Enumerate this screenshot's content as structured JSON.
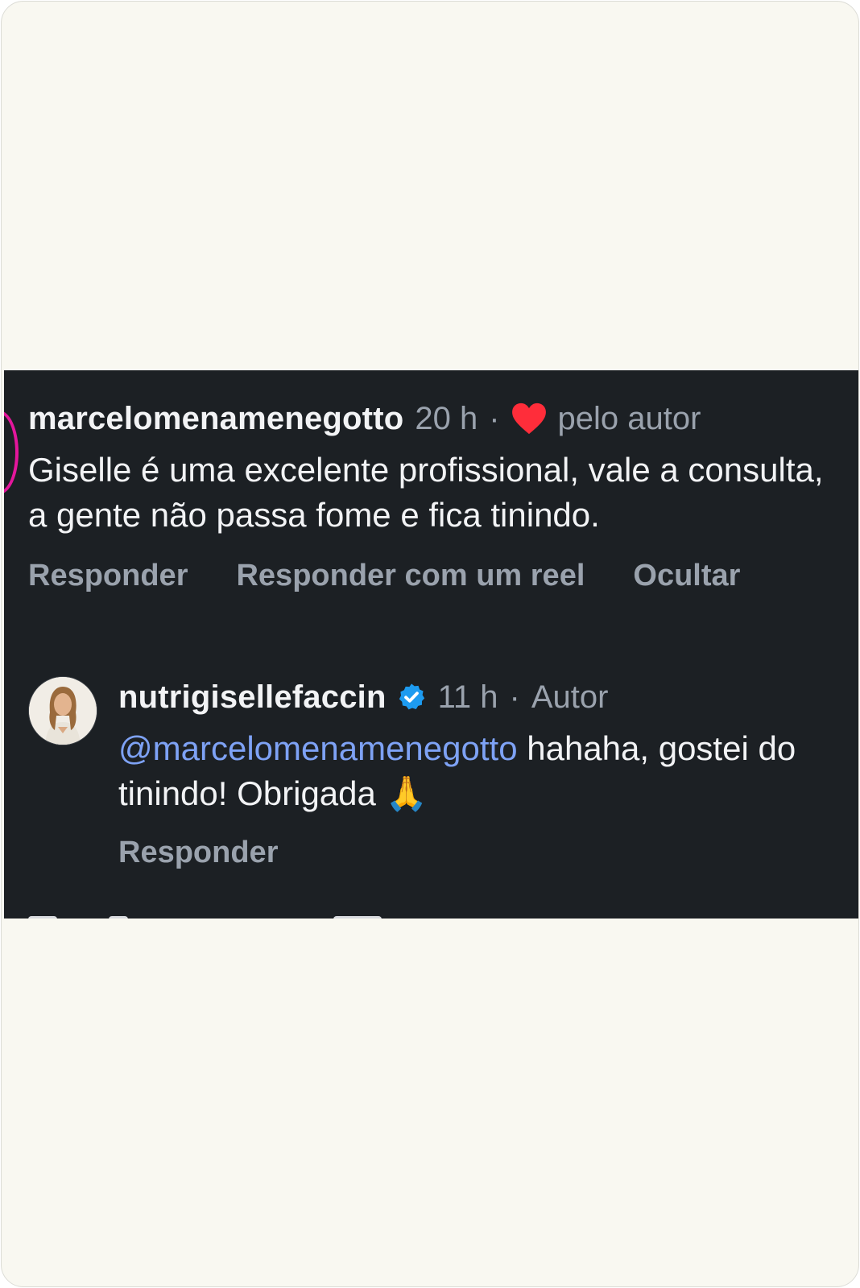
{
  "comment": {
    "username": "marcelomenamenegotto",
    "time": "20 h",
    "separator": "·",
    "liked_label": "pelo autor",
    "text": "Giselle é uma excelente profissional, vale a consulta, a gente não passa fome e fica tinindo.",
    "actions": {
      "reply": "Responder",
      "reply_reel": "Responder com um reel",
      "hide": "Ocultar"
    }
  },
  "reply": {
    "username": "nutrigisellefaccin",
    "time": "11 h",
    "separator": "·",
    "author_label": "Autor",
    "mention": "@marcelomenamenegotto",
    "text": " hahaha, gostei do tinindo! Obrigada ",
    "emoji": "🙏",
    "actions": {
      "reply": "Responder"
    }
  },
  "colors": {
    "panel_bg": "#1c2024",
    "text_primary": "#f2f3f5",
    "text_muted": "#9aa2ad",
    "mention": "#7ea2f5",
    "heart": "#ff2d3a",
    "verified": "#1d9bf0",
    "story_ring": "#e4169c",
    "page_bg": "#f9f8f1"
  },
  "icons": {
    "heart": "heart-icon",
    "verified": "verified-badge-icon",
    "avatar": "profile-avatar"
  }
}
